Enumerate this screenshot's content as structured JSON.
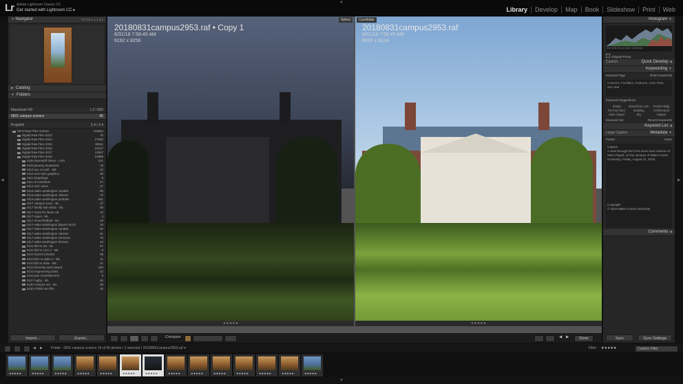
{
  "app": {
    "logo": "Lr",
    "brand_line1": "Adobe Lightroom Classic CC",
    "brand_line2": "Get started with Lightroom CC ▸"
  },
  "modules": [
    "Library",
    "Develop",
    "Map",
    "Book",
    "Slideshow",
    "Print",
    "Web"
  ],
  "active_module": "Library",
  "left_panel": {
    "navigator": "Navigator",
    "navigator_zoom": "FIT  FILL  1:1  3:1",
    "catalog": "Catalog",
    "folders": "Folders",
    "volume1": {
      "name": "Macintosh HD",
      "size": "1.2 / 500"
    },
    "selected_folder": {
      "name": "0831 campus scenics",
      "count": "85"
    },
    "volume2": {
      "name": "ProjekNi",
      "size": "2.4 / 3.4"
    },
    "tree": [
      {
        "name": "WFU Raw Files Archive",
        "count": "118563",
        "level": 0
      },
      {
        "name": "Digital Raw Files 2012",
        "count": "76",
        "level": 1
      },
      {
        "name": "Digital Raw Files 2014",
        "count": "27666",
        "level": 1
      },
      {
        "name": "Digital Raw Files 2015",
        "count": "36211",
        "level": 1
      },
      {
        "name": "Digital Raw Files 2016",
        "count": "24147",
        "level": 1
      },
      {
        "name": "Digital Raw Files 2017",
        "count": "12967",
        "level": 1
      },
      {
        "name": "Digital Raw Files 2018",
        "count": "21888",
        "level": 1
      },
      {
        "name": "0100 deanstaff dinner - LEN",
        "count": "121",
        "level": 2
      },
      {
        "name": "0109 january headshots",
        "count": "78",
        "level": 2
      },
      {
        "name": "0110 ouc vs wofr - BE",
        "count": "24",
        "level": 2
      },
      {
        "name": "0110 over-sam graphics",
        "count": "36",
        "level": 2
      },
      {
        "name": "0111 forgettings",
        "count": "9",
        "level": 2
      },
      {
        "name": "0111 di motivilism",
        "count": "47",
        "level": 2
      },
      {
        "name": "0112 LEC union",
        "count": "27",
        "level": 2
      },
      {
        "name": "0116 wake washington candids",
        "count": "95",
        "level": 2
      },
      {
        "name": "0116 wake washington classes",
        "count": "72",
        "level": 2
      },
      {
        "name": "0116 wake washington portraits",
        "count": "261",
        "level": 2
      },
      {
        "name": "0117 campus snow - BL",
        "count": "37",
        "level": 2
      },
      {
        "name": "0117 family hall mlutio - ML",
        "count": "59",
        "level": 2
      },
      {
        "name": "0117 scars for lanes cat",
        "count": "24",
        "level": 2
      },
      {
        "name": "0117 ropes - ML",
        "count": "3",
        "level": 2
      },
      {
        "name": "0117 snow lfastball - ML",
        "count": "48",
        "level": 2
      },
      {
        "name": "0117 wake washington players lunch",
        "count": "18",
        "level": 2
      },
      {
        "name": "0117 wake washington candids",
        "count": "82",
        "level": 2
      },
      {
        "name": "0117 wake washington classes",
        "count": "81",
        "level": 2
      },
      {
        "name": "0117 wake washington luminous",
        "count": "76",
        "level": 2
      },
      {
        "name": "0117 wake washington theraeo",
        "count": "44",
        "level": 2
      },
      {
        "name": "0121 bbl vs uts - BL",
        "count": "67",
        "level": 2
      },
      {
        "name": "0121 bbl vs UVA 2 - BE",
        "count": "8",
        "level": 2
      },
      {
        "name": "0122 hazed scholars",
        "count": "48",
        "level": 2
      },
      {
        "name": "0123 bbo vs duke 2 - BE",
        "count": "11",
        "level": 2
      },
      {
        "name": "0123 bbl vs duke - BE",
        "count": "21",
        "level": 2
      },
      {
        "name": "0123 diversity sport award",
        "count": "180",
        "level": 2
      },
      {
        "name": "0123 engineering class",
        "count": "44",
        "level": 2
      },
      {
        "name": "0124 pan scramblement",
        "count": "9",
        "level": 2
      },
      {
        "name": "0127 rugby - ML",
        "count": "46",
        "level": 2
      },
      {
        "name": "0130 campus run - ML",
        "count": "39",
        "level": 2
      },
      {
        "name": "0130 F2000 sun film",
        "count": "16",
        "level": 2
      }
    ],
    "import_label": "Import...",
    "export_label": "Export..."
  },
  "viewer": {
    "left": {
      "filename": "20180831campus2953.raf  •  Copy 1",
      "datetime": "8/31/18 7:58:45 AM",
      "dimensions": "6192 x 8256",
      "badge": "Select"
    },
    "right": {
      "filename": "20180831campus2953.raf",
      "datetime": "8/31/18 7:58:45 AM",
      "dimensions": "6093 x 8124",
      "badge": "Candidate"
    },
    "stars_left": "★★★★★",
    "stars_right": "★★★★★"
  },
  "toolbar": {
    "compare": "Compare",
    "done": "Done"
  },
  "right_panel": {
    "histogram": "Histogram",
    "histo_info": "ISO 200   20 mm   f/8.0   1/125 sec",
    "original_photo": "Original Photo",
    "custom": "Custom",
    "quick_develop": "Quick Develop",
    "keywording": "Keywording",
    "keyword_tags": "Keyword Tags",
    "keyword_tags_value": "Enter Keywords",
    "keywords_text": "Columns, Facilities, Features, Lens Flare, Sun Star",
    "keyword_suggestions": "Keyword Suggestions",
    "suggestions": [
      "Shady",
      "Board/Sun Lam",
      "Pundrel Bldg",
      "the front door",
      "Building",
      "Architectural",
      "Wait Chapel",
      "Sky",
      "Chapel"
    ],
    "keyword_set": "Keyword Set",
    "keyword_set_value": "Recent Keywords",
    "keyword_list": "Keyword List",
    "metadata": "Metadata",
    "metadata_preset": "Large Caption",
    "preset": "Preset",
    "preset_value": "None",
    "caption_label": "Caption",
    "caption_text": "A view through the front doors and columns of Wait Chapel, on the campus of Wake Forest University, Friday, August 31, 2018.",
    "copyright_label": "Copyright",
    "copyright_text": "© 2018 Wake Forest University",
    "comments": "Comments",
    "sync_label": "Sync",
    "sync_settings_label": "Sync Settings"
  },
  "filmstrip_bar": {
    "path": "Folder : 0831 campus scenics",
    "info": "14 of 55 photos / 2 selected / 20180831campus2953.raf ▾",
    "filter": "Filter :",
    "filter_value": "Custom Filter"
  },
  "filmstrip": [
    {
      "stars": "★★★★★",
      "tone": "blue"
    },
    {
      "stars": "★★★★★",
      "tone": "blue"
    },
    {
      "stars": "★★★★★",
      "tone": "blue"
    },
    {
      "stars": "★★★★★",
      "tone": "gold"
    },
    {
      "stars": "★★★★★",
      "tone": "gold"
    },
    {
      "stars": "★★★★★",
      "tone": "gold",
      "selected": true
    },
    {
      "stars": "★★★★★",
      "tone": "dark",
      "selected": true
    },
    {
      "stars": "★★★★★",
      "tone": "gold"
    },
    {
      "stars": "★★★★★",
      "tone": "gold"
    },
    {
      "stars": "★★★★★",
      "tone": "gold"
    },
    {
      "stars": "★★★★★",
      "tone": "gold"
    },
    {
      "stars": "★★★★★",
      "tone": "gold"
    },
    {
      "stars": "★★★★★",
      "tone": "gold"
    },
    {
      "stars": "★★★★★",
      "tone": "blue"
    }
  ],
  "colors": {
    "panel": "#262626",
    "viewer_bg": "#535353",
    "active_text": "#e8e8e8",
    "sky_blue": "#8fb4d8",
    "lawn_green": "#5a8a2c"
  }
}
